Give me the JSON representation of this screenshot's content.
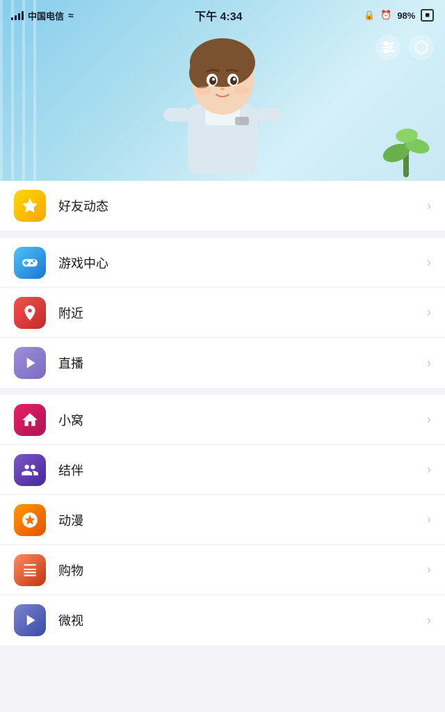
{
  "statusBar": {
    "carrier": "中国电信",
    "time": "下午 4:34",
    "battery": "98%"
  },
  "hero": {
    "settingsIcon": "⊙",
    "profileIcon": "◎"
  },
  "menuGroups": [
    {
      "id": "group1",
      "items": [
        {
          "id": "friends-feed",
          "label": "好友动态",
          "iconClass": "icon-star",
          "iconName": "star-icon"
        }
      ]
    },
    {
      "id": "group2",
      "items": [
        {
          "id": "game-center",
          "label": "游戏中心",
          "iconClass": "icon-game",
          "iconName": "game-icon"
        },
        {
          "id": "nearby",
          "label": "附近",
          "iconClass": "icon-nearby",
          "iconName": "nearby-icon"
        },
        {
          "id": "live",
          "label": "直播",
          "iconClass": "icon-live",
          "iconName": "live-icon"
        }
      ]
    },
    {
      "id": "group3",
      "items": [
        {
          "id": "nest",
          "label": "小窝",
          "iconClass": "icon-nest",
          "iconName": "nest-icon"
        },
        {
          "id": "partner",
          "label": "结伴",
          "iconClass": "icon-partner",
          "iconName": "partner-icon"
        },
        {
          "id": "anime",
          "label": "动漫",
          "iconClass": "icon-anime",
          "iconName": "anime-icon"
        },
        {
          "id": "shop",
          "label": "购物",
          "iconClass": "icon-shop",
          "iconName": "shop-icon"
        },
        {
          "id": "weishi",
          "label": "微视",
          "iconClass": "icon-weishi",
          "iconName": "weishi-icon"
        }
      ]
    }
  ],
  "icons": {
    "star": "⭐",
    "game": "🎮",
    "nearby": "📍",
    "live": "📺",
    "nest": "🏠",
    "partner": "🤝",
    "anime": "😄",
    "shop": "🛒",
    "weishi": "▶",
    "chevron": "›",
    "settings": "⚙",
    "profile": "◎"
  }
}
